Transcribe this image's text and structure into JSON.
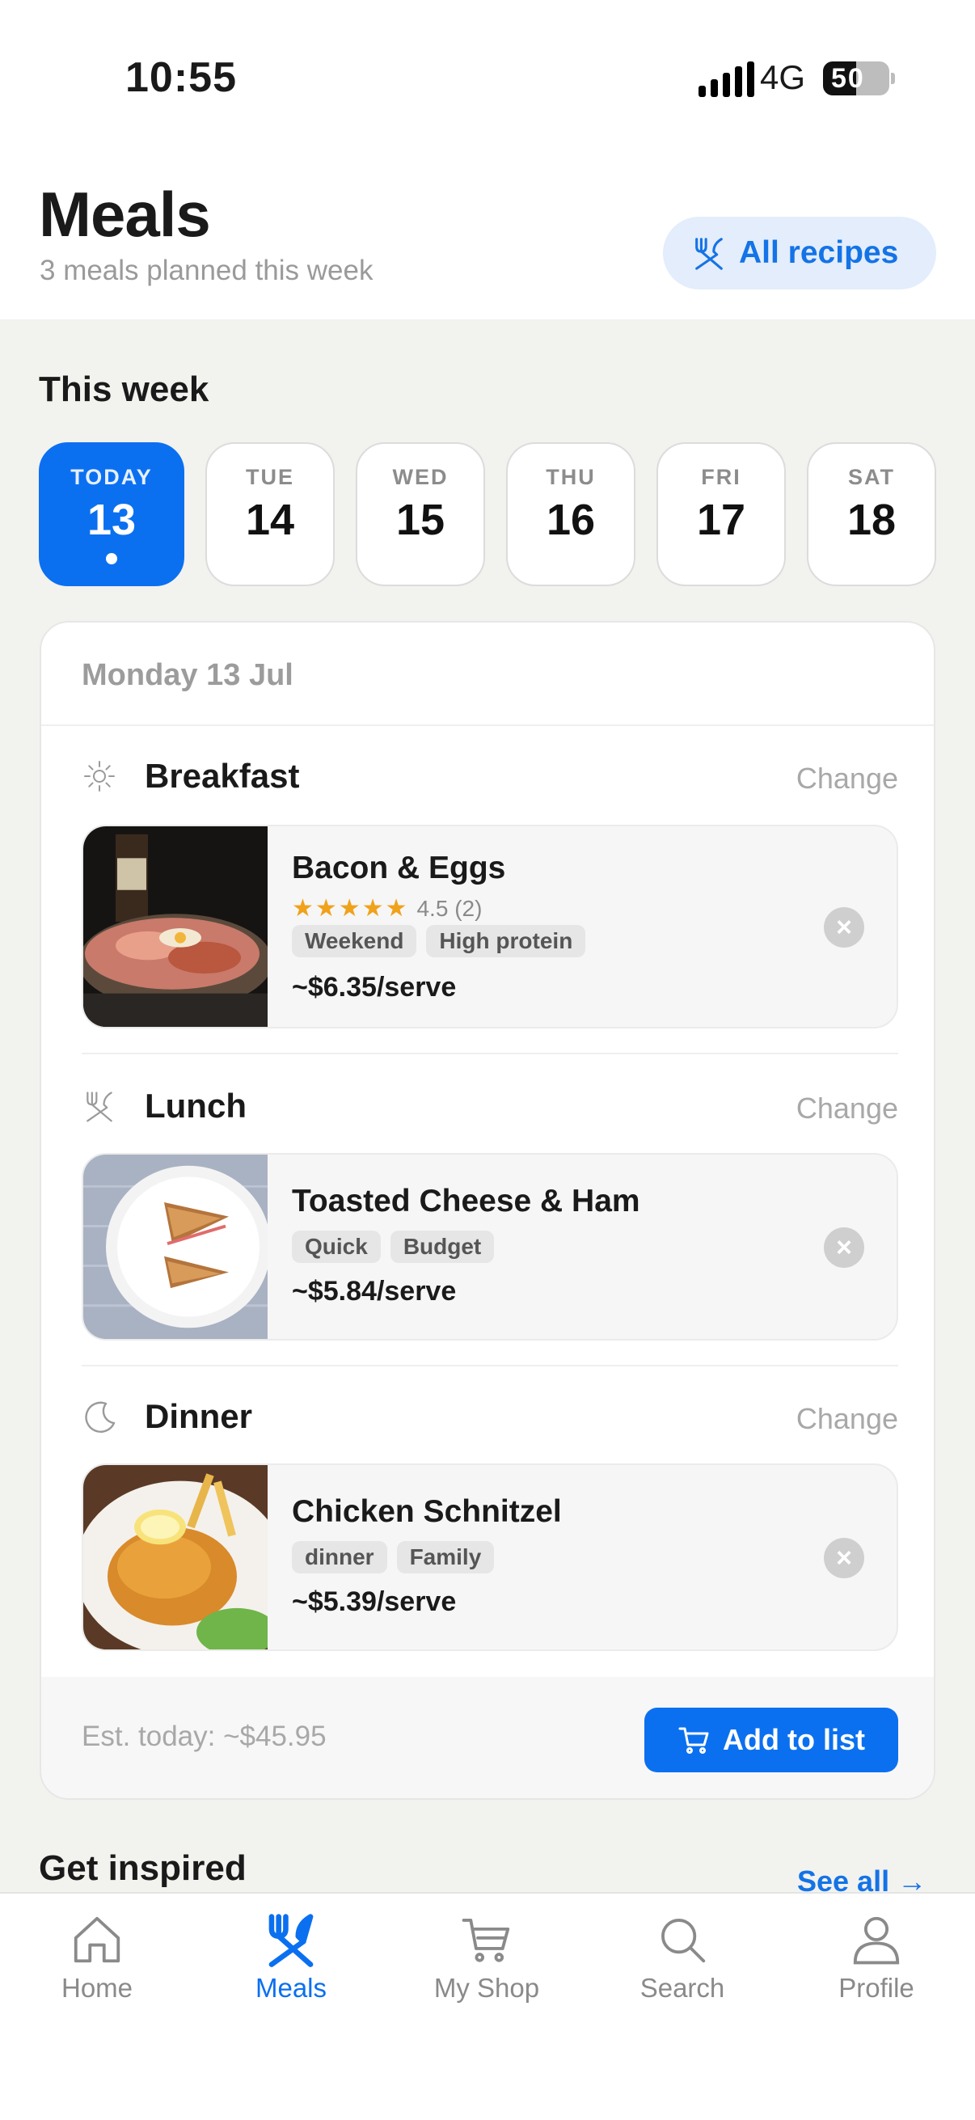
{
  "status_bar": {
    "time": "10:55",
    "network": "4G",
    "battery": "50",
    "battery_level": 0.5
  },
  "header": {
    "title": "Meals",
    "subtitle": "3 meals planned this week",
    "all_recipes_label": "All recipes"
  },
  "week": {
    "title": "This week",
    "days": [
      {
        "name": "TODAY",
        "num": "13",
        "active": true
      },
      {
        "name": "TUE",
        "num": "14"
      },
      {
        "name": "WED",
        "num": "15"
      },
      {
        "name": "THU",
        "num": "16"
      },
      {
        "name": "FRI",
        "num": "17"
      },
      {
        "name": "SAT",
        "num": "18"
      }
    ]
  },
  "plan": {
    "date_label": "Monday 13 Jul",
    "meals": [
      {
        "slot": "Breakfast",
        "change_label": "Change",
        "icon": "sun-icon",
        "recipe": "Bacon & Eggs",
        "stars": "★★★★★",
        "rating": "4.5 (2)",
        "tags": [
          "Weekend",
          "High protein"
        ],
        "price": "~$6.35/serve",
        "remove_label": "×"
      },
      {
        "slot": "Lunch",
        "change_label": "Change",
        "icon": "cutlery-icon",
        "recipe": "Toasted Cheese & Ham",
        "tags": [
          "Quick",
          "Budget"
        ],
        "price": "~$5.84/serve",
        "remove_label": "×"
      },
      {
        "slot": "Dinner",
        "change_label": "Change",
        "icon": "moon-icon",
        "recipe": "Chicken Schnitzel",
        "tags": [
          "dinner",
          "Family"
        ],
        "price": "~$5.39/serve",
        "remove_label": "×"
      }
    ],
    "estimate": "Est. today: ~$45.95",
    "add_to_list_label": "Add to list"
  },
  "inspired": {
    "title": "Get inspired",
    "see_all": "See all →"
  },
  "tabbar": {
    "items": [
      {
        "label": "Home",
        "icon": "home-icon"
      },
      {
        "label": "Meals",
        "icon": "cutlery-icon",
        "active": true
      },
      {
        "label": "My Shop",
        "icon": "cart-icon"
      },
      {
        "label": "Search",
        "icon": "search-icon"
      },
      {
        "label": "Profile",
        "icon": "person-icon"
      }
    ]
  },
  "colors": {
    "accent": "#0b70f0",
    "star": "#f0a21b",
    "background": "#f2f2ef"
  }
}
